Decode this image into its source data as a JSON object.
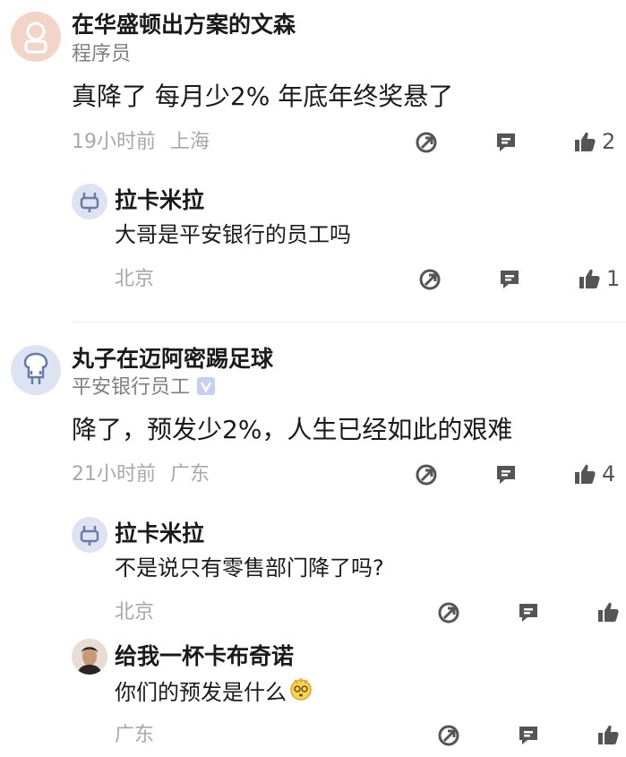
{
  "comments": [
    {
      "user": "在华盛顿出方案的文森",
      "subtitle": "程序员",
      "text": "真降了  每月少2%  年底年终奖悬了",
      "time": "19小时前",
      "location": "上海",
      "likes": "2",
      "replies": [
        {
          "user": "拉卡米拉",
          "text": "大哥是平安银行的员工吗",
          "location": "北京",
          "likes": "1"
        }
      ]
    },
    {
      "user": "丸子在迈阿密踢足球",
      "subtitle": "平安银行员工",
      "text": "降了，预发少2%，人生已经如此的艰难",
      "time": "21小时前",
      "location": "广东",
      "likes": "4",
      "replies": [
        {
          "user": "拉卡米拉",
          "text": "不是说只有零售部门降了吗?",
          "location": "北京"
        },
        {
          "user": "给我一杯卡布奇诺",
          "text": "你们的预发是什么",
          "location": "广东"
        }
      ]
    }
  ],
  "icons": {
    "share": "share-icon",
    "comment": "comment-icon",
    "like": "thumbs-up-icon",
    "verified": "verified-badge-icon",
    "emoji": "dizzy-emoji-icon"
  },
  "colors": {
    "text": "#1a1a1a",
    "meta": "#a8a8a8",
    "icon": "#555555",
    "verified": "#c7cff5"
  }
}
